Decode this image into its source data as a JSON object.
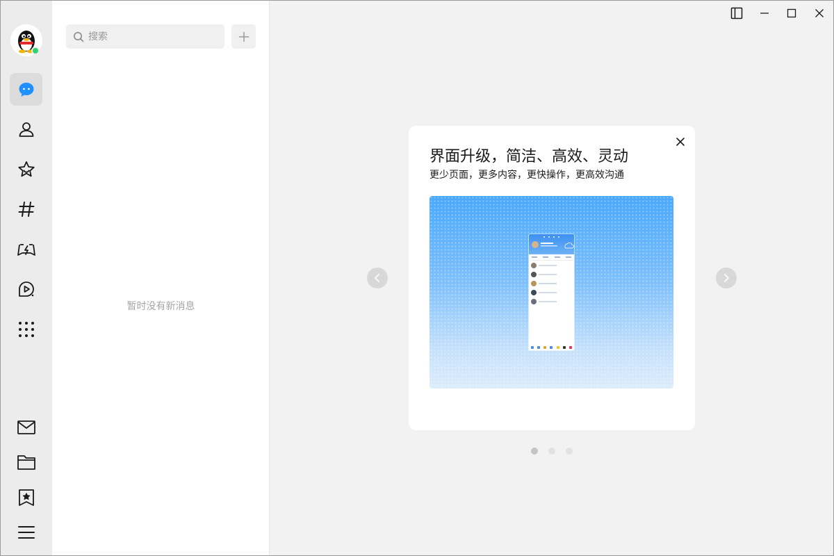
{
  "rail": {
    "nav": [
      {
        "id": "messages",
        "icon": "chat-bubble-icon",
        "active": true
      },
      {
        "id": "contacts",
        "icon": "person-icon"
      },
      {
        "id": "favorites",
        "icon": "star-icon"
      },
      {
        "id": "channels",
        "icon": "hashtag-icon"
      },
      {
        "id": "games",
        "icon": "game-controller-icon"
      },
      {
        "id": "video",
        "icon": "video-icon"
      },
      {
        "id": "apps",
        "icon": "grid-icon"
      }
    ],
    "bottom": [
      {
        "id": "mail",
        "icon": "mail-icon"
      },
      {
        "id": "files",
        "icon": "folder-icon"
      },
      {
        "id": "bookmarks",
        "icon": "bookmark-icon"
      },
      {
        "id": "menu",
        "icon": "menu-icon"
      }
    ],
    "status_color": "#2fd36e"
  },
  "list": {
    "search_placeholder": "搜索",
    "empty_text": "暂时没有新消息"
  },
  "card": {
    "title": "界面升级，简洁、高效、灵动",
    "subtitle": "更少页面，更多内容，更快操作，更高效沟通",
    "pager": {
      "count": 3,
      "active": 0
    }
  },
  "colors": {
    "accent": "#1e90ff",
    "preview_gradient_top": "#49a8fb"
  }
}
